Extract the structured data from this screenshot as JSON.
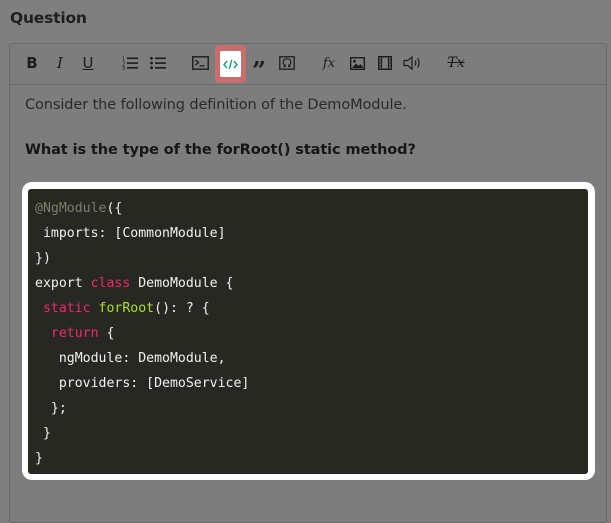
{
  "section": {
    "title": "Question"
  },
  "toolbar": {
    "buttons": [
      {
        "label": "B",
        "icon": "bold-icon"
      },
      {
        "label": "I",
        "icon": "italic-icon"
      },
      {
        "label": "U",
        "icon": "underline-icon"
      },
      {
        "icon": "ordered-list-icon"
      },
      {
        "icon": "bullet-list-icon"
      },
      {
        "icon": "terminal-icon"
      },
      {
        "icon": "code-icon",
        "state": "highlighted"
      },
      {
        "label": "”",
        "icon": "blockquote-icon"
      },
      {
        "icon": "omega-icon"
      },
      {
        "label": "fx",
        "icon": "formula-icon"
      },
      {
        "icon": "image-icon"
      },
      {
        "icon": "video-icon"
      },
      {
        "icon": "audio-icon"
      },
      {
        "label": "Tx",
        "icon": "clear-format-icon"
      }
    ]
  },
  "content": {
    "intro": "Consider the following definition of the DemoModule.",
    "question": "What is the type of the forRoot() static method?"
  },
  "code": {
    "lines": [
      [
        {
          "t": "@NgModule",
          "c": "deco"
        },
        {
          "t": "({"
        }
      ],
      [
        {
          "t": " imports: [CommonModule]"
        }
      ],
      [
        {
          "t": "})"
        }
      ],
      [
        {
          "t": "export "
        },
        {
          "t": "class",
          "c": "kw"
        },
        {
          "t": " DemoModule {"
        }
      ],
      [
        {
          "t": " "
        },
        {
          "t": "static",
          "c": "kw"
        },
        {
          "t": " "
        },
        {
          "t": "forRoot",
          "c": "fn"
        },
        {
          "t": "(): ? {"
        }
      ],
      [
        {
          "t": "  "
        },
        {
          "t": "return",
          "c": "kw"
        },
        {
          "t": " {"
        }
      ],
      [
        {
          "t": "   ngModule: DemoModule,"
        }
      ],
      [
        {
          "t": "   providers: [DemoService]"
        }
      ],
      [
        {
          "t": "  };"
        }
      ],
      [
        {
          "t": " }"
        }
      ],
      [
        {
          "t": "}"
        }
      ]
    ]
  },
  "colors": {
    "code_background": "#272822",
    "keyword": "#f0286c",
    "function": "#a6e22e",
    "decorator": "#7f7c69",
    "highlight": "#c86e6e"
  }
}
